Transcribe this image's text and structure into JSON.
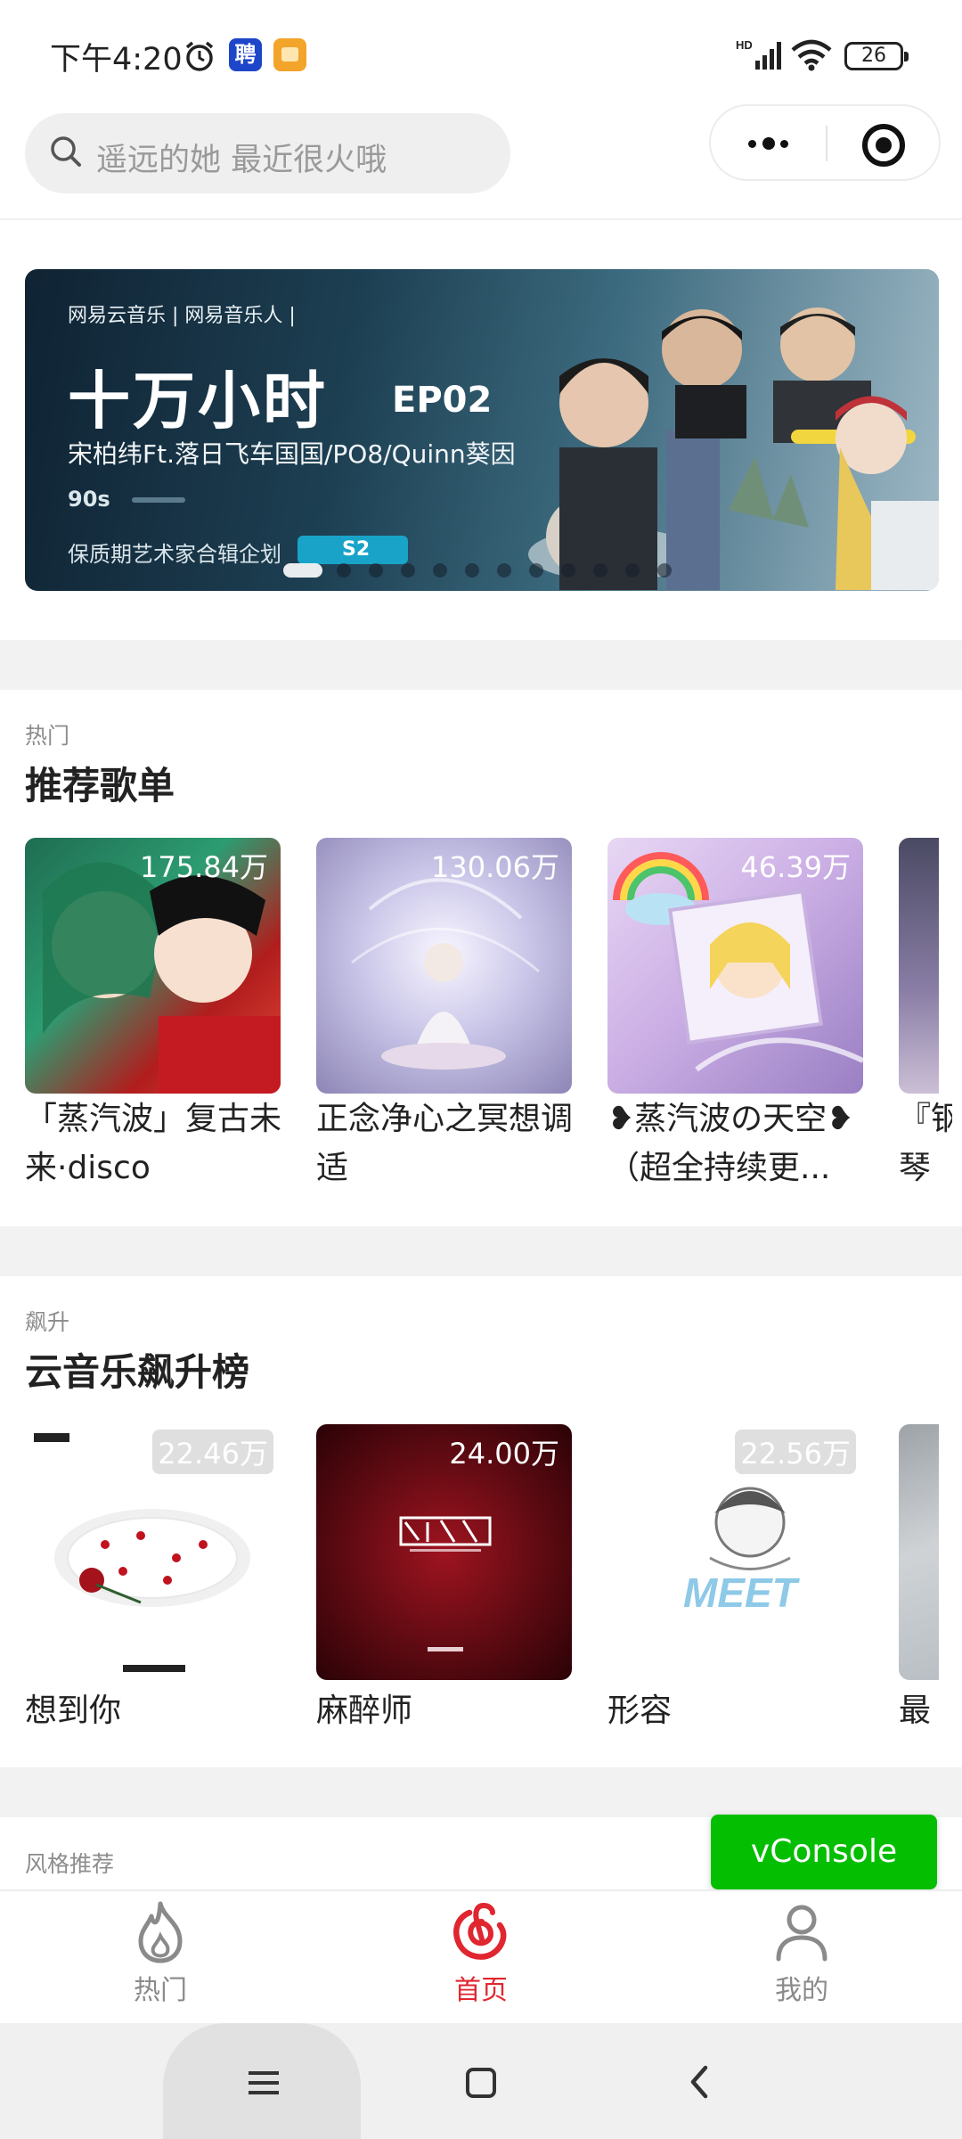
{
  "status_bar": {
    "time": "下午4:20",
    "app_badge_label": "聘",
    "battery": "26",
    "network": "HD"
  },
  "search": {
    "placeholder": "遥远的她 最近很火哦"
  },
  "banner": {
    "brand": "网易云音乐 | 网易音乐人 |",
    "title": "十万小时",
    "episode": "EP02",
    "artists": "宋柏纬Ft.落日飞车国国/PO8/Quinn葵因",
    "duration": "90s",
    "series": "保质期艺术家合辑企划",
    "badge": "S2",
    "slide_count": 12,
    "active_slide": 1
  },
  "hot_section": {
    "subtitle": "热门",
    "title": "推荐歌单",
    "items": [
      {
        "plays": "175.84万",
        "name": "「蒸汽波」复古未来·disco"
      },
      {
        "plays": "130.06万",
        "name": "正念净心之冥想调适"
      },
      {
        "plays": "46.39万",
        "name": "❥蒸汽波の天空❥（超全持续更..."
      },
      {
        "plays": "",
        "name": "『钢琴"
      }
    ]
  },
  "rising_section": {
    "subtitle": "飙升",
    "title": "云音乐飙升榜",
    "items": [
      {
        "plays": "22.46万",
        "name": "想到你"
      },
      {
        "plays": "24.00万",
        "name": "麻醉师"
      },
      {
        "plays": "22.56万",
        "name": "形容"
      },
      {
        "plays": "",
        "name": "最后"
      }
    ]
  },
  "style_section": {
    "subtitle": "风格推荐"
  },
  "vconsole": {
    "label": "vConsole"
  },
  "tab_bar": {
    "tabs": [
      {
        "label": "热门",
        "icon": "flame-icon",
        "active": false
      },
      {
        "label": "首页",
        "icon": "netease-music-icon",
        "active": true
      },
      {
        "label": "我的",
        "icon": "user-icon",
        "active": false
      }
    ]
  },
  "colors": {
    "accent": "#e0262f",
    "vconsole": "#04be02",
    "inactive_tab": "#8a8a8a"
  }
}
